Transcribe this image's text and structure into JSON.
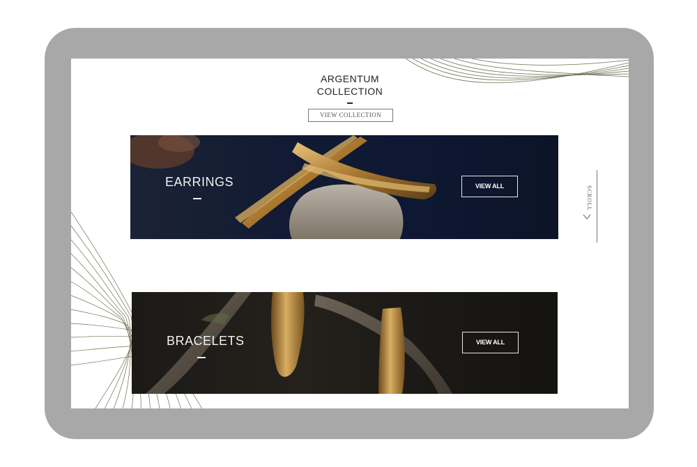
{
  "collection": {
    "title_line1": "ARGENTUM",
    "title_line2": "COLLECTION",
    "button_label": "VIEW COLLECTION"
  },
  "banners": [
    {
      "label": "EARRINGS",
      "button_label": "VIEW ALL"
    },
    {
      "label": "BRACELETS",
      "button_label": "VIEW ALL"
    }
  ],
  "scroll": {
    "label": "SCROLL"
  },
  "colors": {
    "device_frame": "#a8a8a8",
    "earrings_bg": "#0e1832",
    "bracelets_bg": "#1c1a17",
    "gold": "#c49a4e",
    "line_art": "#6b6f50"
  },
  "icons": {
    "scroll": "chevron-down-icon"
  }
}
